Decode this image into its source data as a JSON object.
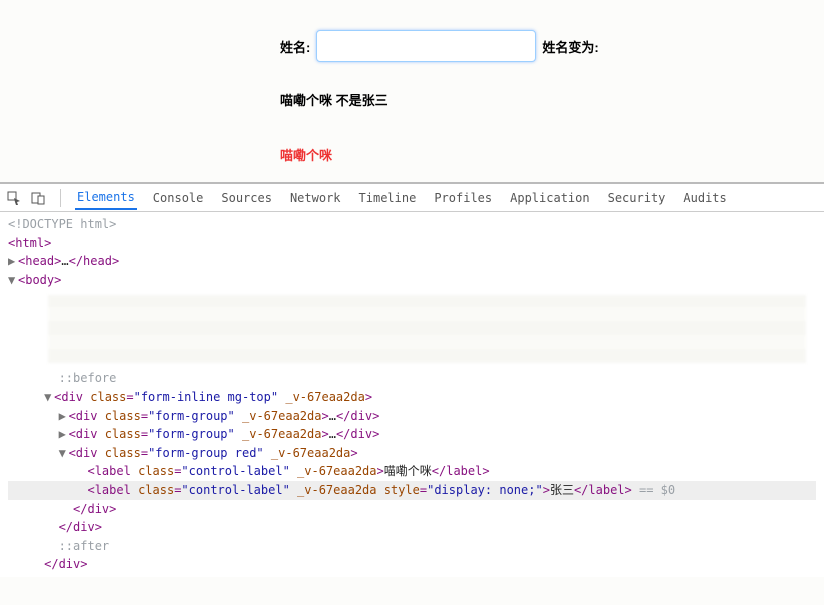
{
  "form": {
    "name_label": "姓名:",
    "name_value": "",
    "changed_label": "姓名变为:"
  },
  "line1": "喵嘞个咪 不是张三",
  "line2": "喵嘞个咪",
  "devtools": {
    "tabs": [
      "Elements",
      "Console",
      "Sources",
      "Network",
      "Timeline",
      "Profiles",
      "Application",
      "Security",
      "Audits"
    ],
    "active_tab": "Elements"
  },
  "dom": {
    "l0": "<!DOCTYPE html>",
    "l1_open": "<html>",
    "l2": "<head>…</head>",
    "l3_open": "<body>",
    "l4": "::before",
    "l5_tag": "div",
    "l5_attrs": "class=\"form-inline mg-top\" _v-67eaa2da",
    "l6_tag": "div",
    "l6_attrs": "class=\"form-group\" _v-67eaa2da",
    "l6_rest": ">…</div>",
    "l7_tag": "div",
    "l7_attrs": "class=\"form-group\" _v-67eaa2da",
    "l7_rest": ">…</div>",
    "l8_tag": "div",
    "l8_attrs": "class=\"form-group red\" _v-67eaa2da",
    "l9_tag": "label",
    "l9_attrs": "class=\"control-label\" _v-67eaa2da",
    "l9_text": "喵嘞个咪",
    "l10_tag": "label",
    "l10_attrs": "class=\"control-label\" _v-67eaa2da style=\"display: none;\"",
    "l10_text": "张三",
    "l10_suffix": " == $0",
    "l11": "</div>",
    "l12": "</div>",
    "l13": "::after",
    "l14": "</div>"
  }
}
